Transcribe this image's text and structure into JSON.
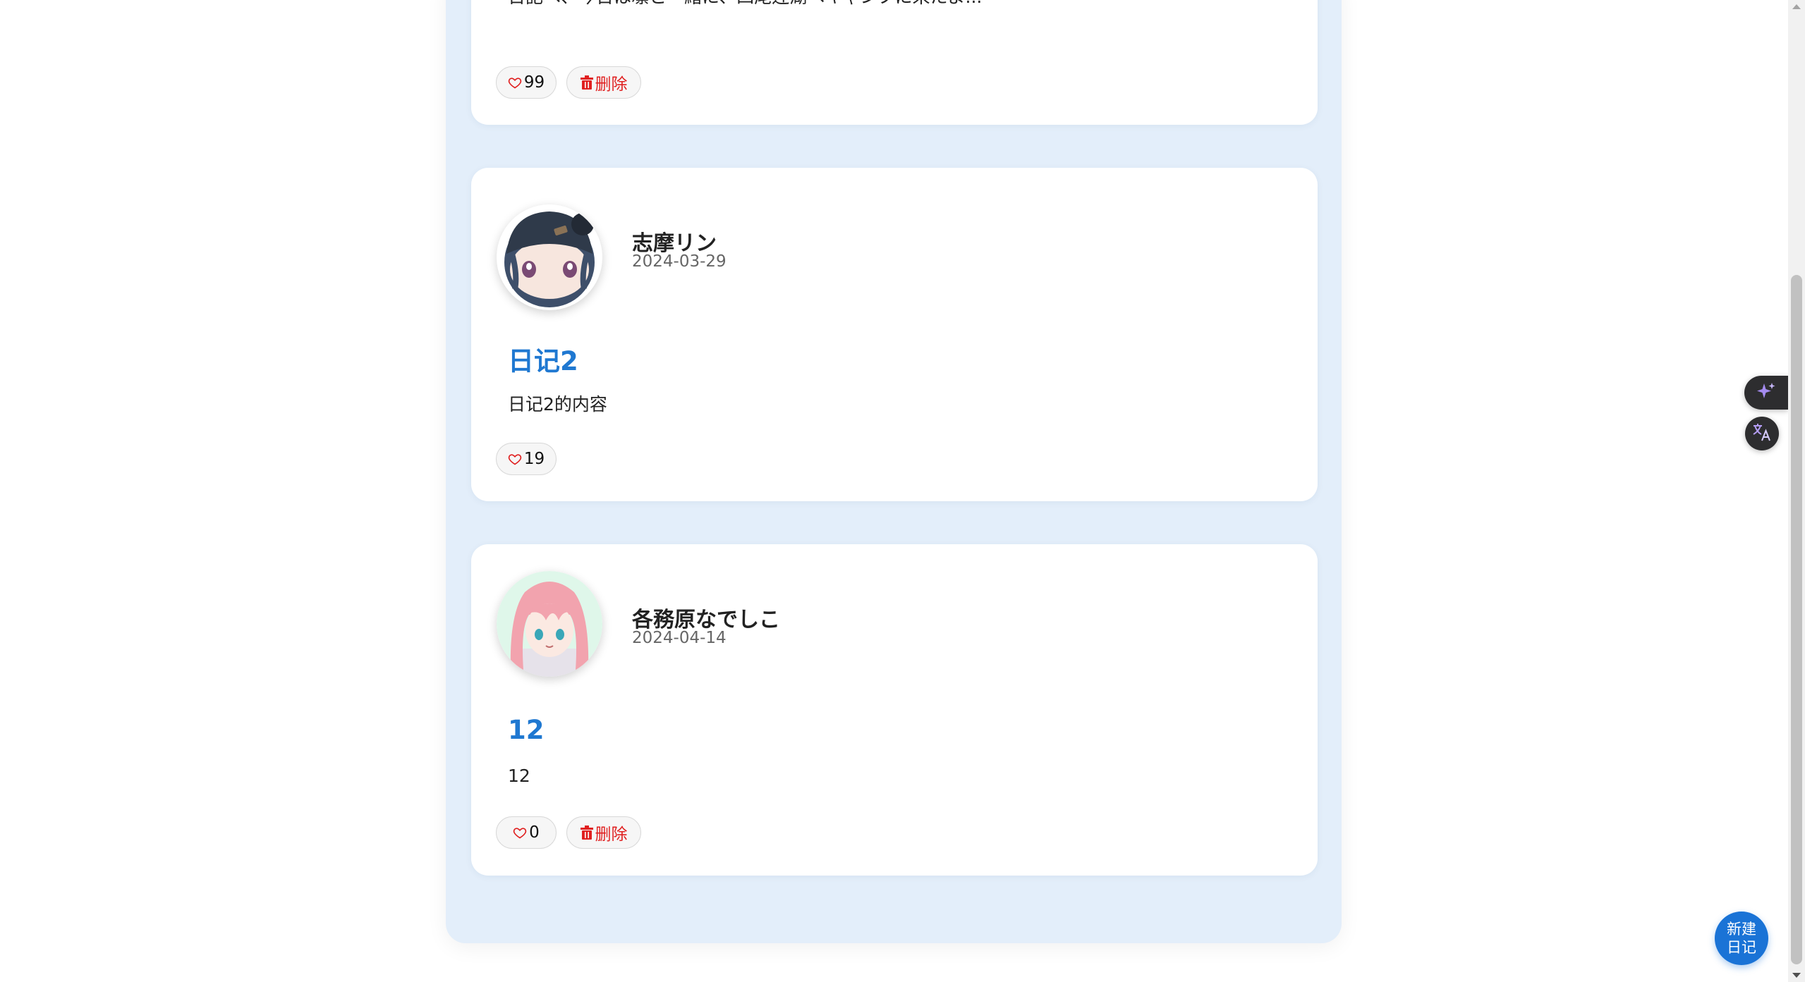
{
  "ui": {
    "like_icon": "heart-outline-icon",
    "delete_icon": "trash-icon",
    "like_color": "#e02020",
    "delete_color": "#e02020",
    "title_color": "#1f78d1",
    "panel_color": "#e3eefa",
    "fab_color": "#1a73d6"
  },
  "posts": [
    {
      "excerpt": "日記へ、今日は凛と一緒に、四尾连湖へキャンプに来たよ...",
      "likes": "99",
      "delete_label": "删除"
    },
    {
      "author": "志摩リン",
      "date": "2024-03-29",
      "title": "日记2",
      "excerpt": "日记2的内容",
      "likes": "19",
      "avatar": "rin-avatar"
    },
    {
      "author": "各務原なでしこ",
      "date": "2024-04-14",
      "title": "12",
      "excerpt": "12",
      "likes": "0",
      "delete_label": "删除",
      "avatar": "nadeshiko-avatar"
    }
  ],
  "fab": {
    "line1": "新建",
    "line2": "日记"
  },
  "side_tools": {
    "ai": "sparkle-icon",
    "translate": "translate-icon"
  }
}
